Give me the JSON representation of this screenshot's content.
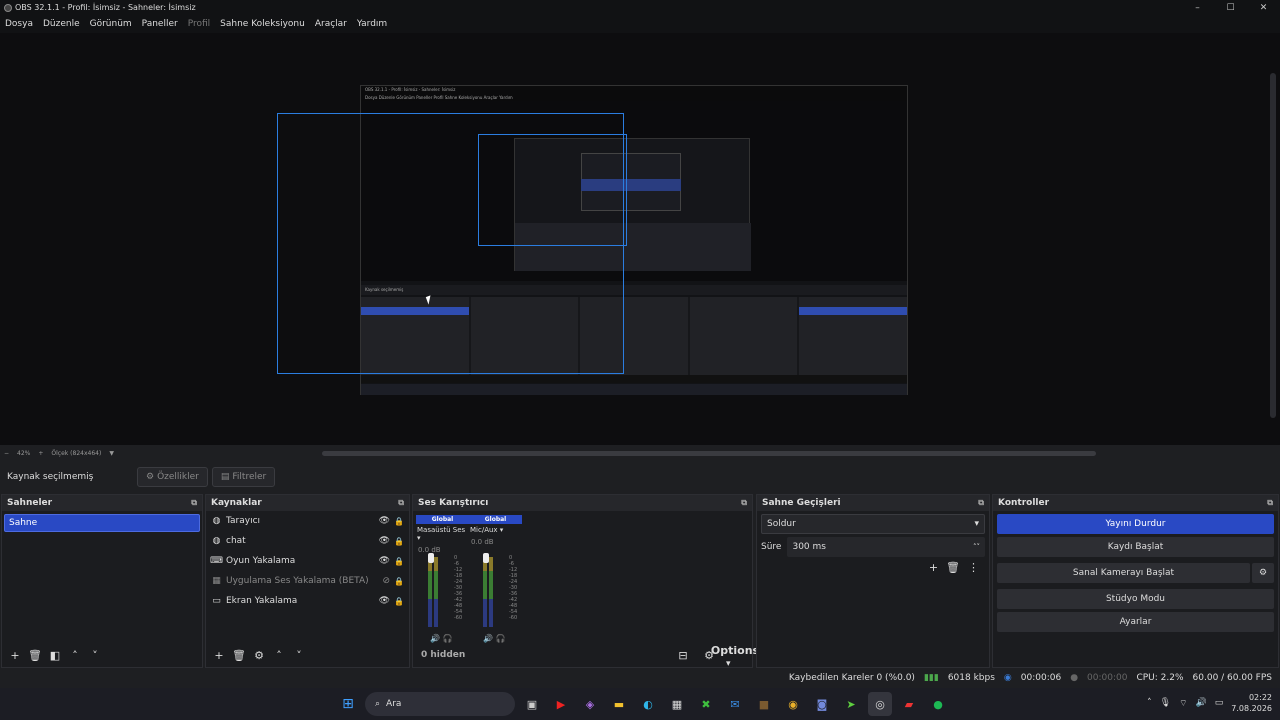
{
  "window": {
    "title": "OBS 32.1.1 - Profil: İsimsiz - Sahneler: İsimsiz",
    "controls": [
      "–",
      "☐",
      "✕"
    ]
  },
  "menu": [
    {
      "label": "Dosya",
      "enabled": true
    },
    {
      "label": "Düzenle",
      "enabled": true
    },
    {
      "label": "Görünüm",
      "enabled": true
    },
    {
      "label": "Paneller",
      "enabled": true
    },
    {
      "label": "Profil",
      "enabled": false
    },
    {
      "label": "Sahne Koleksiyonu",
      "enabled": true
    },
    {
      "label": "Araçlar",
      "enabled": true
    },
    {
      "label": "Yardım",
      "enabled": true
    }
  ],
  "preview": {
    "zoom": "42%",
    "scale_label": "Ölçek (824x464)",
    "inner": {
      "title": "OBS 32.1.1 - Profil: İsimsiz - Sahneler: İsimsiz",
      "menu": "Dosya  Düzenle  Görünüm  Paneller  Profil  Sahne Koleksiyonu  Araçlar  Yardım",
      "source_bar": "Kaynak seçilmemiş"
    }
  },
  "source_bar": {
    "label": "Kaynak seçilmemiş",
    "properties": "Özellikler",
    "filters": "Filtreler"
  },
  "scenes": {
    "title": "Sahneler",
    "items": [
      "Sahne"
    ]
  },
  "sources": {
    "title": "Kaynaklar",
    "items": [
      {
        "label": "Tarayıcı",
        "icon": "globe-icon",
        "visible": true
      },
      {
        "label": "chat",
        "icon": "globe-icon",
        "visible": true
      },
      {
        "label": "Oyun Yakalama",
        "icon": "gamepad-icon",
        "visible": true
      },
      {
        "label": "Uygulama Ses Yakalama (BETA)",
        "icon": "app-audio-icon",
        "visible": false
      },
      {
        "label": "Ekran Yakalama",
        "icon": "monitor-icon",
        "visible": true
      }
    ]
  },
  "mixer": {
    "title": "Ses Karıştırıcı",
    "channels": [
      {
        "badge": "Global",
        "name": "Masaüstü Ses",
        "db": "0.0 dB"
      },
      {
        "badge": "Global",
        "name": "Mic/Aux",
        "db": "0.0 dB"
      }
    ],
    "scale": [
      "0",
      "-6",
      "-12",
      "-18",
      "-24",
      "-30",
      "-36",
      "-42",
      "-48",
      "-54",
      "-60"
    ],
    "hidden": "0 hidden",
    "options": "Options"
  },
  "transitions": {
    "title": "Sahne Geçişleri",
    "selected": "Soldur",
    "duration_label": "Süre",
    "duration_value": "300 ms"
  },
  "controls": {
    "title": "Kontroller",
    "buttons": [
      "Yayını Durdur",
      "Kaydı Başlat",
      "Sanal Kamerayı Başlat",
      "Stüdyo Modu",
      "Ayarlar"
    ]
  },
  "status": {
    "dropped": "Kaybedilen Kareler 0 (%0.0)",
    "bitrate": "6018 kbps",
    "stream_time": "00:00:06",
    "record_time": "00:00:00",
    "cpu": "CPU: 2.2%",
    "fps": "60.00 / 60.00 FPS"
  },
  "taskbar": {
    "search": "Ara",
    "time": "02:22",
    "date": "7.08.2026"
  },
  "colors": {
    "accent": "#2949c4",
    "selection": "#2b7de0",
    "bg": "#1e1f22"
  }
}
